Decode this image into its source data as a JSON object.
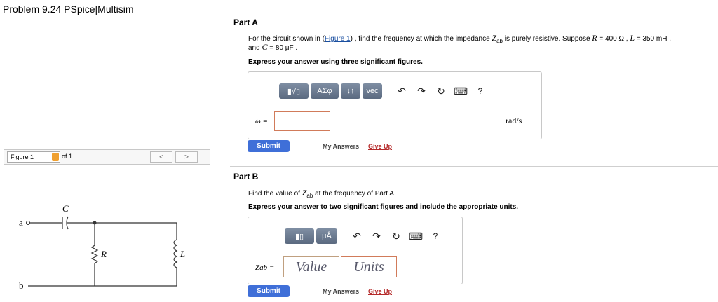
{
  "header": {
    "title": "Problem 9.24 PSpice|Multisim"
  },
  "part_a": {
    "label": "Part A",
    "prompt_before_link": "For the circuit shown in (",
    "figure_link": "Figure 1",
    "prompt_after_link": ") , find the frequency at which the impedance ",
    "z_symbol": "Z",
    "z_sub": "ab",
    "prompt_suppose": " is purely resistive. Suppose ",
    "r_symbol": "R",
    "r_value": " = 400 Ω , ",
    "l_symbol": "L",
    "l_value": " = 350 mH ,",
    "line2_and": "and ",
    "c_symbol": "C",
    "c_value": " = 80 μF .",
    "instruction": "Express your answer using three significant figures.",
    "toolbar": {
      "templates_label": "▮√▯",
      "greek_label": "ΑΣφ",
      "arrows_label": "↓↑",
      "vec_label": "vec",
      "undo_glyph": "↶",
      "redo_glyph": "↷",
      "reset_glyph": "↻",
      "keyboard_glyph": "⌨",
      "help_glyph": "?"
    },
    "answer_label": "ω =",
    "answer_value": "",
    "units_label": "rad/s",
    "submit_label": "Submit",
    "my_answers_label": "My Answers",
    "give_up_label": "Give Up"
  },
  "part_b": {
    "label": "Part B",
    "prompt_before": "Find the value of ",
    "z_symbol": "Z",
    "z_sub": "ab",
    "prompt_after": " at the frequency of Part A.",
    "instruction": "Express your answer to two significant figures and include the appropriate units.",
    "toolbar": {
      "templates_label": "▮▯",
      "units_label": "μÅ",
      "undo_glyph": "↶",
      "redo_glyph": "↷",
      "reset_glyph": "↻",
      "keyboard_glyph": "⌨",
      "help_glyph": "?"
    },
    "answer_label": "Zab =",
    "value_placeholder": "Value",
    "units_placeholder": "Units",
    "submit_label": "Submit",
    "my_answers_label": "My Answers",
    "give_up_label": "Give Up"
  },
  "figure": {
    "select_label": "Figure 1",
    "of_label": "of 1",
    "prev_glyph": "<",
    "next_glyph": ">",
    "node_a": "a",
    "node_b": "b",
    "cap_label": "C",
    "res_label": "R",
    "ind_label": "L"
  }
}
